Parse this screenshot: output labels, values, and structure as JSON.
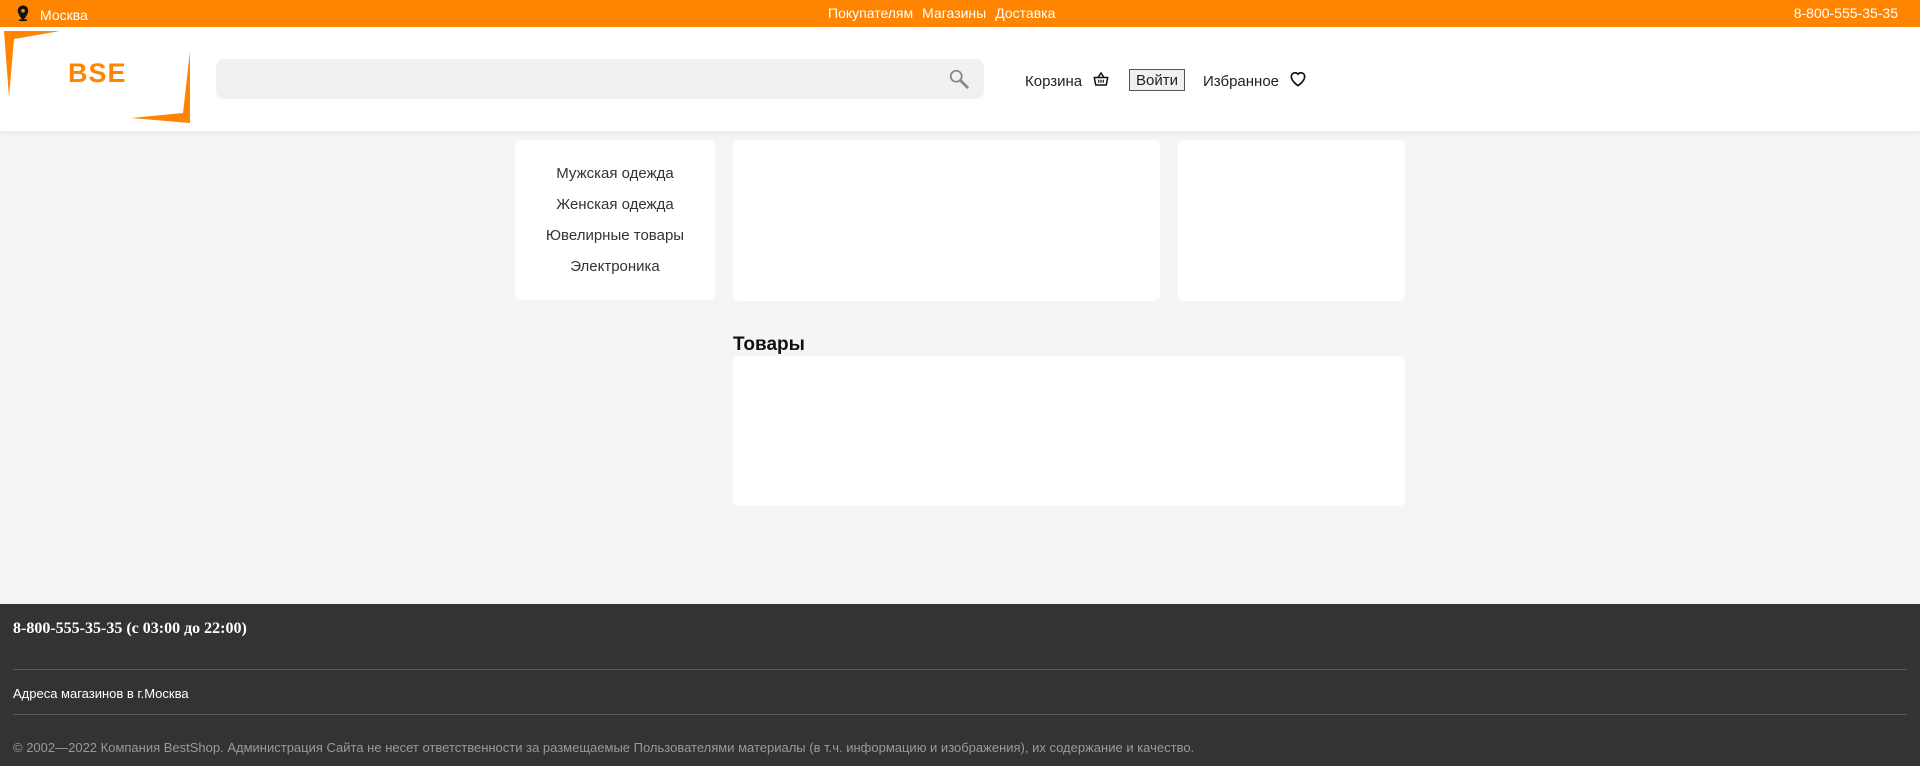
{
  "topbar": {
    "city": "Москва",
    "nav": [
      "Покупателям",
      "Магазины",
      "Доставка"
    ],
    "phone": "8-800-555-35-35"
  },
  "header": {
    "logo_text": "BSE",
    "search_placeholder": "",
    "cart_label": "Корзина",
    "login_label": "Войти",
    "favorites_label": "Избранное"
  },
  "catalog": {
    "items": [
      "Мужская одежда",
      "Женская одежда",
      "Ювелирные товары",
      "Электроника"
    ]
  },
  "products": {
    "title": "Товары"
  },
  "footer": {
    "phone_hours": "8-800-555-35-35 (с 03:00 до 22:00)",
    "addresses": "Адреса магазинов в г.Москва",
    "copyright": "© 2002—2022 Компания BestShop. Администрация Сайта не несет ответственности за размещаемые Пользователями материалы (в т.ч. информацию и изображения), их содержание и качество."
  },
  "colors": {
    "accent": "#ff8400",
    "footer_bg": "#333333",
    "page_bg": "#f5f5f5"
  }
}
